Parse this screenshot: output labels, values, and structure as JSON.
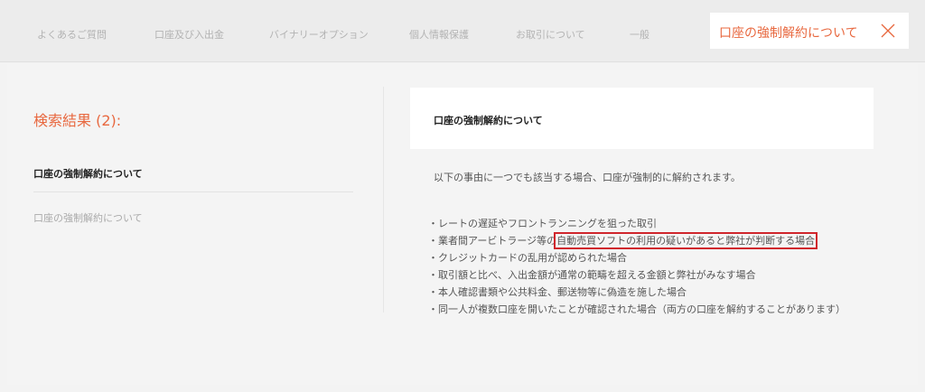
{
  "nav": {
    "tabs": [
      "よくあるご質問",
      "口座及び入出金",
      "バイナリーオプション",
      "個人情報保護",
      "お取引について",
      "一般"
    ],
    "active_tab": "口座の強制解約について"
  },
  "sidebar": {
    "results_title": "検索結果 (2):",
    "results": [
      "口座の強制解約について",
      "口座の強制解約について"
    ]
  },
  "article": {
    "title": "口座の強制解約について",
    "intro": "以下の事由に一つでも該当する場合、口座が強制的に解約されます。",
    "reasons": [
      "・レートの遅延やフロントランニングを狙った取引",
      "・業者間アービトラージ等の",
      "自動売買ソフトの利用の疑いがあると弊社が判断する場合",
      "・クレジットカードの乱用が認められた場合",
      "・取引額と比べ、入出金額が通常の範疇を超える金額と弊社がみなす場合",
      "・本人確認書類や公共料金、郵送物等に偽造を施した場合",
      "・同一人が複数口座を開いたことが確認された場合（両方の口座を解約することがあります）"
    ]
  },
  "colors": {
    "accent": "#e8683f",
    "highlight_box": "#d0262c"
  },
  "icons": {
    "close": "close-icon"
  }
}
